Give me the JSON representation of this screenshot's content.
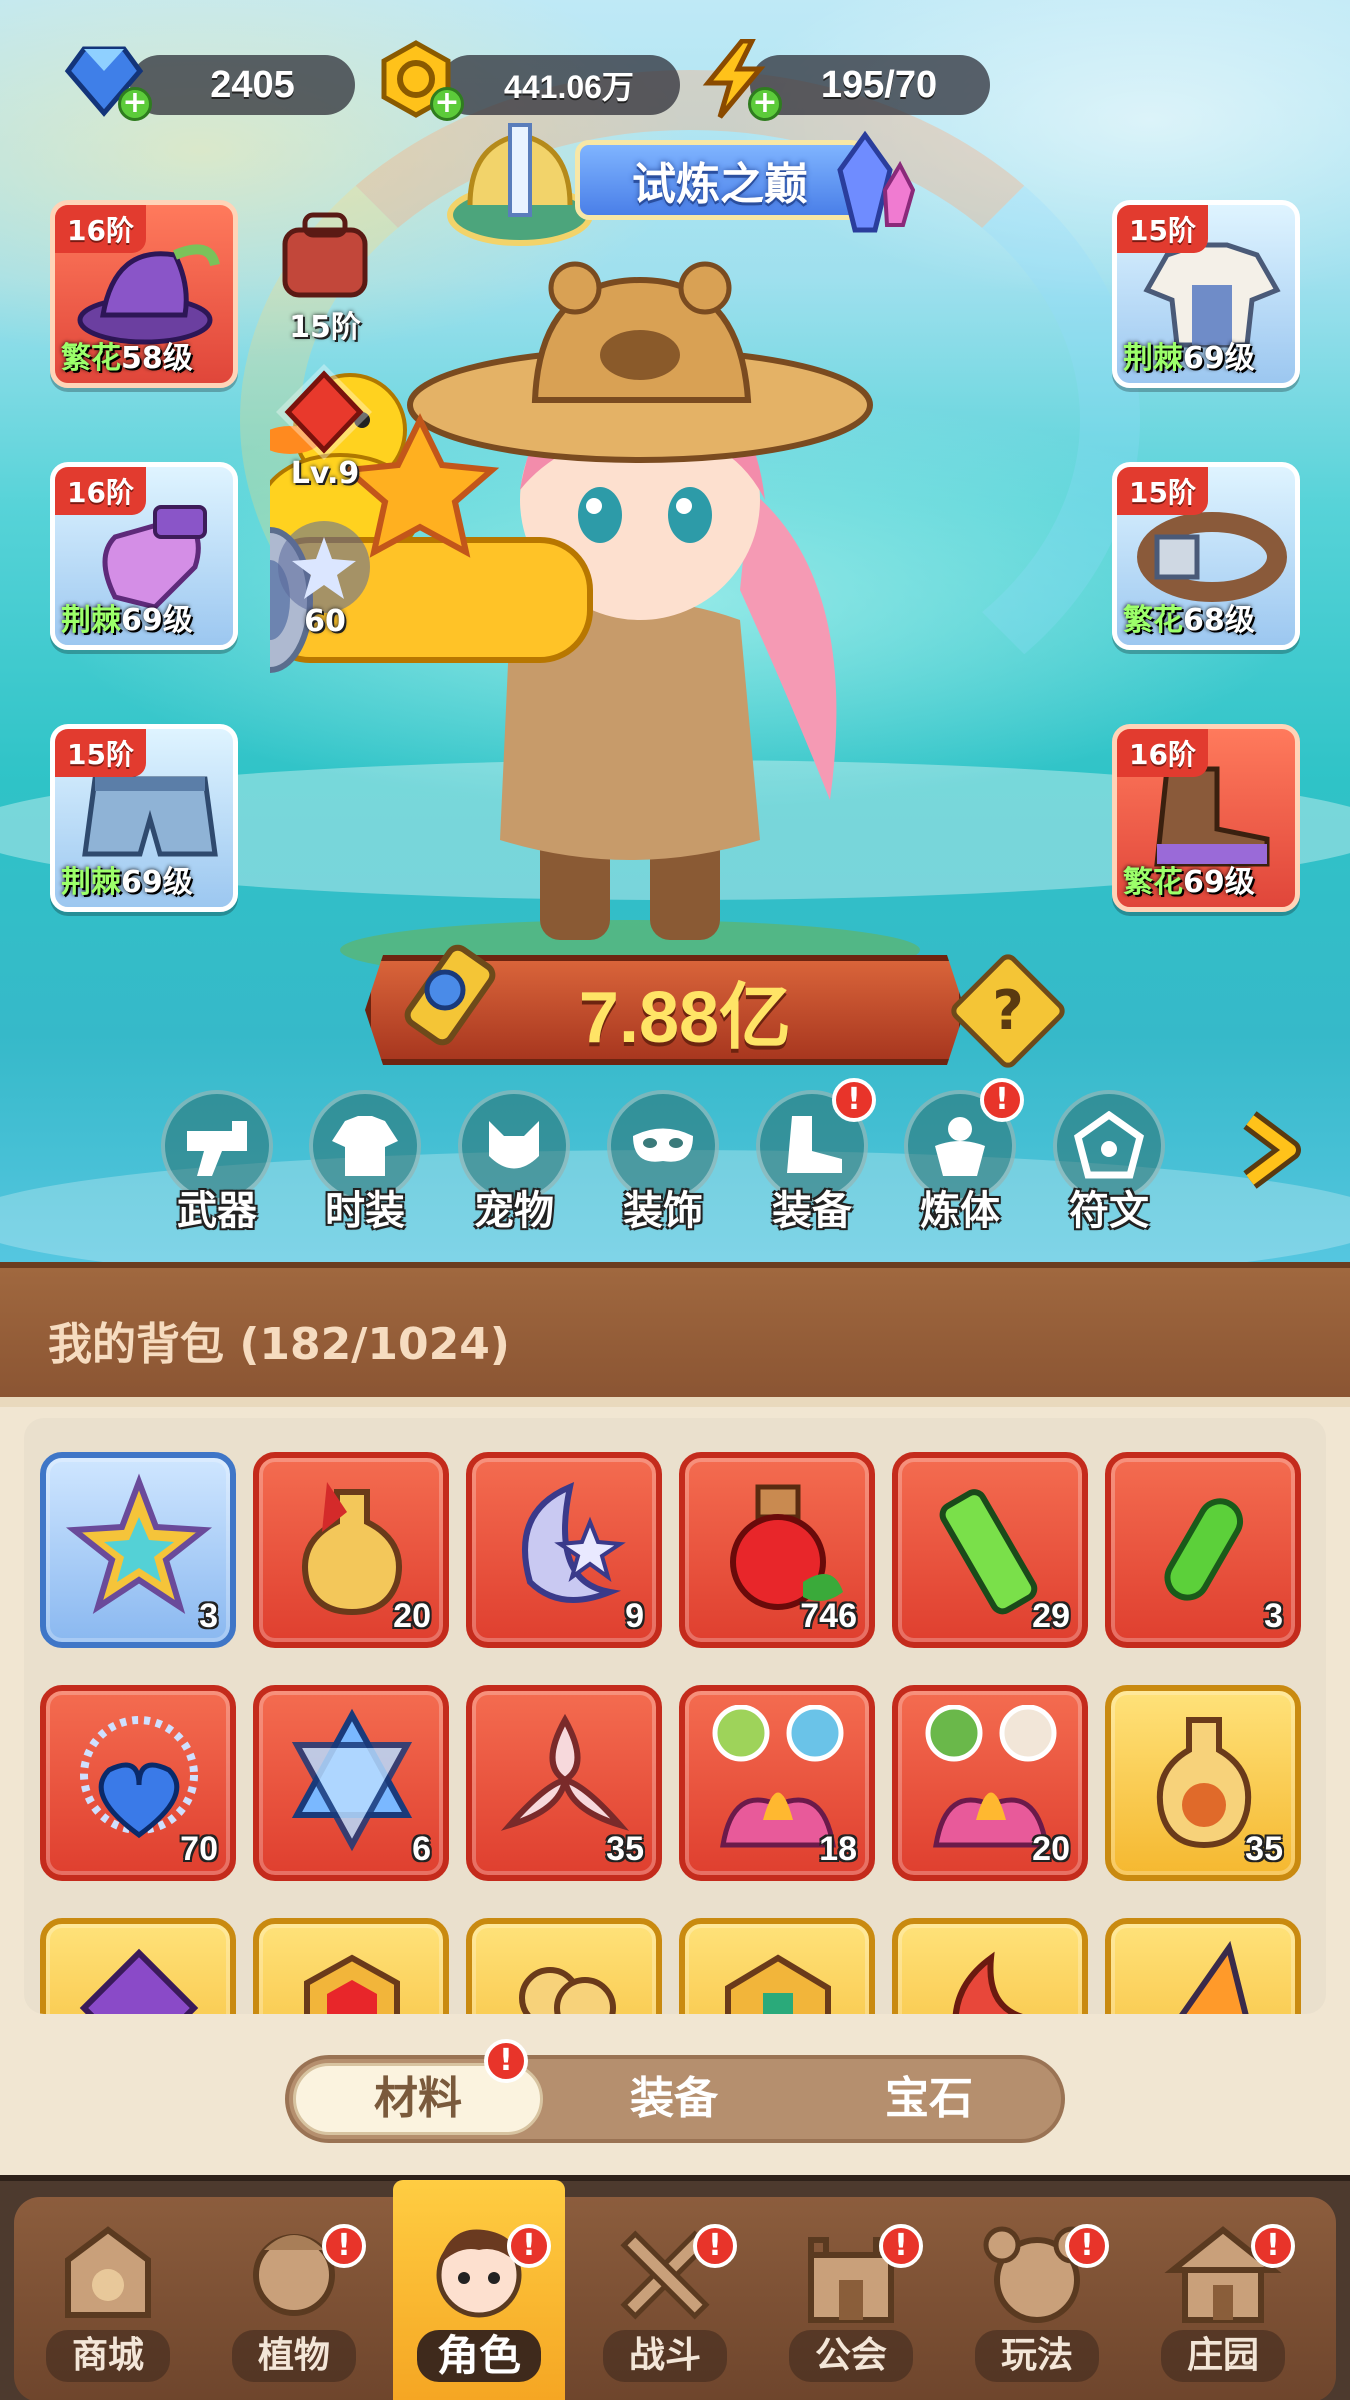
{
  "resources": {
    "gems": "2405",
    "gold": "441.06万",
    "energy": "195/70"
  },
  "title_banner": "试炼之巅",
  "left_slots": [
    {
      "tier": "16阶",
      "quality": "繁花",
      "level": "58级"
    },
    {
      "tier": "16阶",
      "quality": "荆棘",
      "level": "69级"
    },
    {
      "tier": "15阶",
      "quality": "荆棘",
      "level": "69级"
    }
  ],
  "right_slots": [
    {
      "tier": "15阶",
      "quality": "荆棘",
      "level": "69级"
    },
    {
      "tier": "15阶",
      "quality": "繁花",
      "level": "68级"
    },
    {
      "tier": "16阶",
      "quality": "繁花",
      "level": "69级"
    }
  ],
  "mini_stats": {
    "bag_tier": "15阶",
    "crystal_level": "Lv.9",
    "orb_value": "60"
  },
  "power": "7.88亿",
  "help_label": "?",
  "functions": [
    {
      "label": "武器",
      "badge": false
    },
    {
      "label": "时装",
      "badge": false
    },
    {
      "label": "宠物",
      "badge": false
    },
    {
      "label": "装饰",
      "badge": false
    },
    {
      "label": "装备",
      "badge": true
    },
    {
      "label": "炼体",
      "badge": true
    },
    {
      "label": "符文",
      "badge": false
    }
  ],
  "backpack": {
    "title": "我的背包 (182/1024)",
    "items_row1": [
      "3",
      "20",
      "9",
      "746",
      "29",
      "3"
    ],
    "items_row2": [
      "70",
      "6",
      "35",
      "18",
      "20",
      "35"
    ]
  },
  "tabs": {
    "materials": "材料",
    "equipment": "装备",
    "gems": "宝石",
    "badge": "!"
  },
  "bottom_nav": [
    {
      "label": "商城",
      "badge": false
    },
    {
      "label": "植物",
      "badge": true
    },
    {
      "label": "角色",
      "badge": true
    },
    {
      "label": "战斗",
      "badge": true
    },
    {
      "label": "公会",
      "badge": true
    },
    {
      "label": "玩法",
      "badge": true
    },
    {
      "label": "庄园",
      "badge": true
    }
  ],
  "badge_glyph": "!"
}
